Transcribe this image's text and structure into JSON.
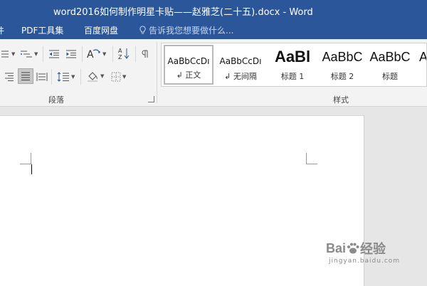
{
  "window": {
    "title": "word2016如何制作明星卡贴——赵雅芝(二十五).docx - Word"
  },
  "menubar": {
    "items": [
      {
        "label": "件"
      },
      {
        "label": "PDF工具集"
      },
      {
        "label": "百度网盘"
      }
    ],
    "tell_me": "告诉我您想要做什么..."
  },
  "ribbon": {
    "paragraph_group": "段落",
    "styles_group": "样式",
    "styles": [
      {
        "preview": "AaBbCcDı",
        "name": "↲ 正文"
      },
      {
        "preview": "AaBbCcDı",
        "name": "↲ 无间隔"
      },
      {
        "preview": "AaBl",
        "name": "标题 1"
      },
      {
        "preview": "AaBbC",
        "name": "标题 2"
      },
      {
        "preview": "AaBbC",
        "name": "标题"
      },
      {
        "preview": "A",
        "name": ""
      }
    ]
  },
  "watermark": {
    "brand": "Bai",
    "brand_end": "经验",
    "sub": "jingyan.baidu.com"
  },
  "colors": {
    "title_bar": "#2b579a",
    "ribbon_bg": "#f3f3f3",
    "workspace": "#e6e6e6"
  }
}
